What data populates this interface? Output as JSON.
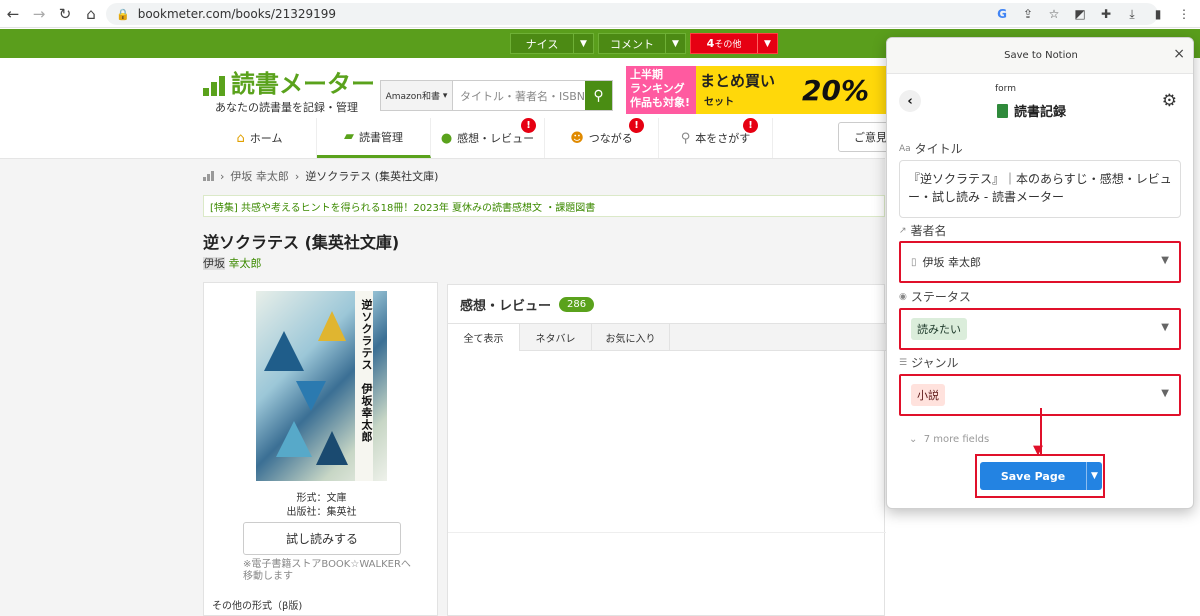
{
  "browser": {
    "url": "bookmeter.com/books/21329199"
  },
  "topstrip": {
    "nice": "ナイス",
    "comment": "コメント",
    "other_count": "4",
    "other": "その他"
  },
  "header": {
    "logo_title": "読書メーター",
    "logo_sub": "あなたの読書量を記録・管理",
    "search_category": "Amazon和書",
    "search_placeholder": "タイトル・著者名・ISBN",
    "banner_text1": "上半期",
    "banner_text2": "ランキング",
    "banner_text3": "作品も対象!",
    "banner_bulk": "まとめ買い",
    "banner_set": "セット",
    "banner_pct": "20%"
  },
  "nav": {
    "items": [
      {
        "label": "ホーム",
        "icon": "house-icon"
      },
      {
        "label": "読書管理",
        "icon": "book-icon"
      },
      {
        "label": "感想・レビュー",
        "icon": "speech-bubble-icon",
        "badge": "!"
      },
      {
        "label": "つながる",
        "icon": "people-icon",
        "badge": "!"
      },
      {
        "label": "本をさがす",
        "icon": "magnifier-icon",
        "badge": "!"
      }
    ],
    "opinion": "ご意見"
  },
  "breadcrumb": {
    "author": "伊坂 幸太郎",
    "current": "逆ソクラテス (集英社文庫)"
  },
  "notice": "[特集] 共感や考えるヒントを得られる18冊！2023年 夏休みの読書感想文 ・課題図書",
  "book": {
    "title": "逆ソクラテス (集英社文庫)",
    "author_prefix": "伊坂",
    "author_link": "幸太郎",
    "cover_title": "逆ソクラテス　伊坂幸太郎",
    "format": "形式：文庫",
    "publisher": "出版社：集英社",
    "try_read": "試し読みする",
    "ebook_note": "※電子書籍ストアBOOK☆WALKERへ移動します",
    "other_formats": "その他の形式（β版)"
  },
  "reviews": {
    "title": "感想・レビュー",
    "count": "286",
    "tabs": [
      "全て表示",
      "ネタバレ",
      "お気に入り"
    ]
  },
  "notion": {
    "header": "Save to Notion",
    "close": "×",
    "form_label": "form",
    "database": "読書記録",
    "fields": {
      "title_label": "タイトル",
      "title_value": "『逆ソクラテス』｜本のあらすじ・感想・レビュー・試し読み - 読書メーター",
      "author_label": "著者名",
      "author_value": "伊坂 幸太郎",
      "status_label": "ステータス",
      "status_value": "読みたい",
      "genre_label": "ジャンル",
      "genre_value": "小説"
    },
    "more_fields": "7 more fields",
    "save_button": "Save Page"
  },
  "colors": {
    "brand_green": "#5aa21c",
    "notion_blue": "#2383e2",
    "highlight_red": "#e0102a"
  }
}
